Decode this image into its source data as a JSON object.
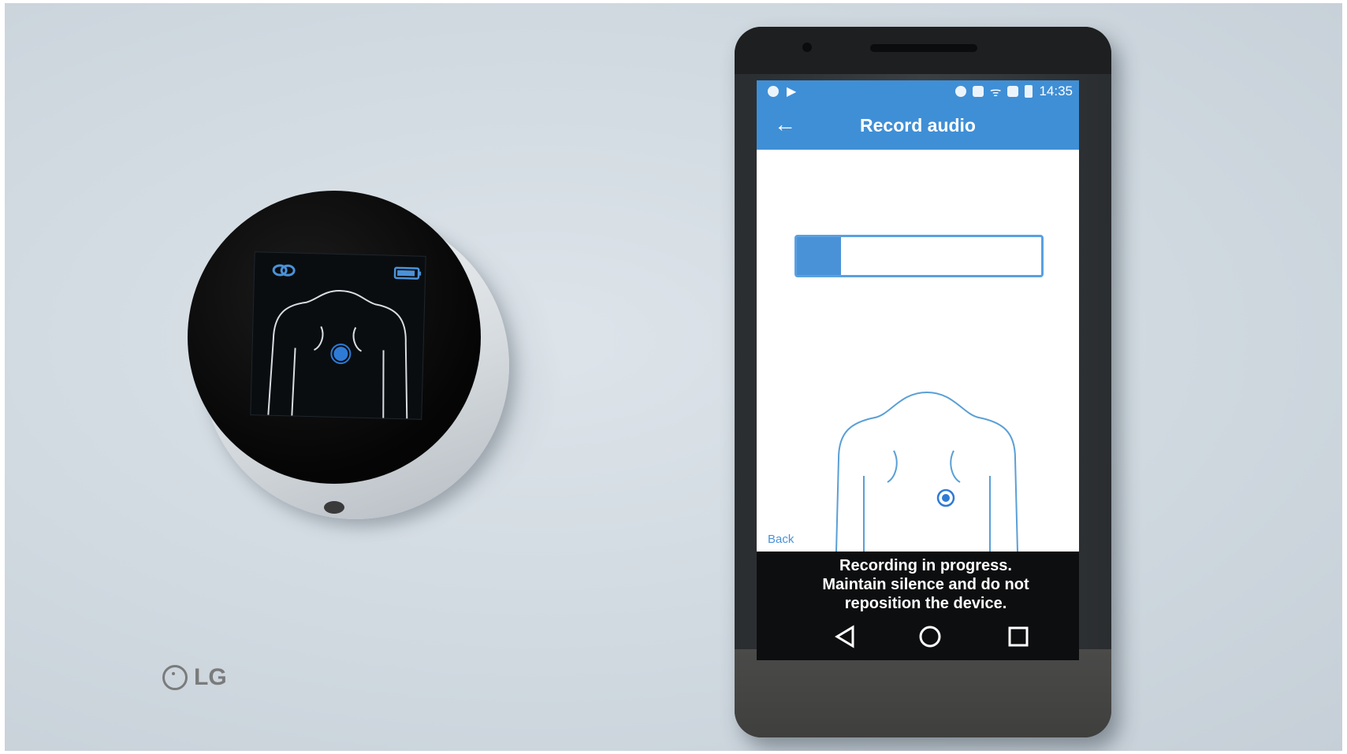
{
  "stethoscope_device": {
    "screen": {
      "link_icon": "link-icon",
      "battery_icon": "battery-icon",
      "marker_color": "#2e7bd6"
    }
  },
  "phone": {
    "brand": "LG",
    "status_bar": {
      "time": "14:35",
      "background": "#3f8fd6"
    },
    "app_bar": {
      "title": "Record audio",
      "back_icon": "arrow-left-icon"
    },
    "progress": {
      "value_percent": 18,
      "color": "#4a92d8"
    },
    "back_link": "Back",
    "message": {
      "line1": "Recording in progress.",
      "line2": "Maintain silence and do not",
      "line3": "reposition the device."
    },
    "nav": {
      "back_icon": "triangle-back-icon",
      "home_icon": "circle-home-icon",
      "recents_icon": "square-recents-icon"
    }
  }
}
